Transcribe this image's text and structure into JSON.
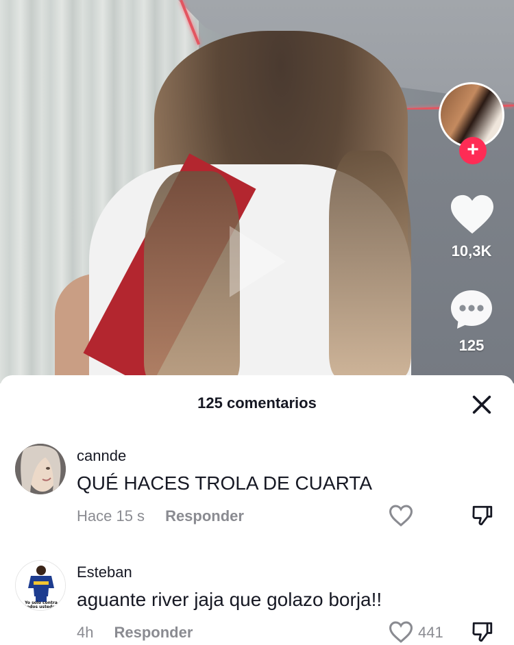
{
  "video": {
    "likes": "10,3K",
    "comments": "125"
  },
  "sheet": {
    "title": "125 comentarios"
  },
  "comments": [
    {
      "user": "cannde",
      "text": "QUÉ HACES TROLA DE CUARTA",
      "time": "Hace 15 s",
      "reply": "Responder",
      "likes": ""
    },
    {
      "user": "Esteban",
      "text": "aguante river jaja que golazo borja!!",
      "time": "4h",
      "reply": "Responder",
      "likes": "441",
      "avatar_caption": "Yo solo contra todos ustedes"
    }
  ],
  "colors": {
    "accent": "#fe2c55",
    "muted": "#8a8b91",
    "text": "#161823"
  },
  "icons": [
    "play-icon",
    "plus-icon",
    "heart-icon",
    "comment-bubble-icon",
    "close-icon",
    "dislike-icon"
  ]
}
